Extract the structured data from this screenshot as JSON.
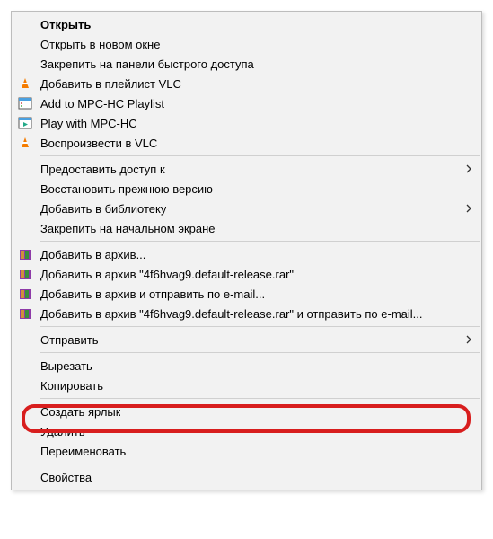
{
  "menu": {
    "open": "Открыть",
    "open_new_window": "Открыть в новом окне",
    "pin_quick_access": "Закрепить на панели быстрого доступа",
    "add_vlc_playlist": "Добавить в плейлист VLC",
    "add_mpc_playlist": "Add to MPC-HC Playlist",
    "play_mpc": "Play with MPC-HC",
    "play_vlc": "Воспроизвести в VLC",
    "give_access": "Предоставить доступ к",
    "restore_prev": "Восстановить прежнюю версию",
    "add_library": "Добавить в библиотеку",
    "pin_start": "Закрепить на начальном экране",
    "add_archive": "Добавить в архив...",
    "add_archive_name": "Добавить в архив \"4f6hvag9.default-release.rar\"",
    "add_archive_email": "Добавить в архив и отправить по e-mail...",
    "add_archive_name_email": "Добавить в архив \"4f6hvag9.default-release.rar\" и отправить по e-mail...",
    "send_to": "Отправить",
    "cut": "Вырезать",
    "copy": "Копировать",
    "create_shortcut": "Создать ярлык",
    "delete": "Удалить",
    "rename": "Переименовать",
    "properties": "Свойства"
  }
}
